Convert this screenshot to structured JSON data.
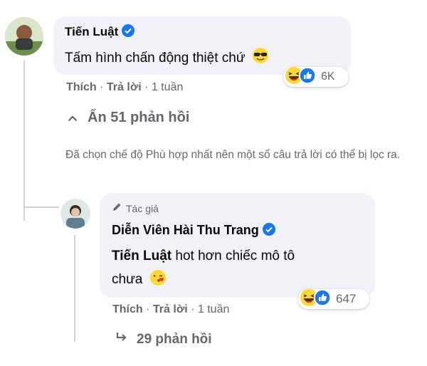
{
  "comment1": {
    "author": "Tiến Luật",
    "text": "Tấm hình chấn động thiệt chứ",
    "reaction_count": "6K",
    "actions": {
      "like": "Thích",
      "reply": "Trả lời",
      "time": "1 tuần"
    }
  },
  "hide_replies": "Ẩn 51 phản hồi",
  "filter_notice": "Đã chọn chế độ Phù hợp nhất nên một số câu trả lời có thể bị lọc ra.",
  "comment2": {
    "badge": "Tác giả",
    "author": "Diễn Viên Hài Thu Trang",
    "mention": "Tiến Luật",
    "text": " hot hơn chiếc mô tô chưa",
    "reaction_count": "647",
    "actions": {
      "like": "Thích",
      "reply": "Trả lời",
      "time": "1 tuần"
    }
  },
  "more_replies": "29 phản hồi",
  "colors": {
    "verified": "#1877f2",
    "bubble": "#f0f2f5",
    "meta": "#65676b"
  }
}
